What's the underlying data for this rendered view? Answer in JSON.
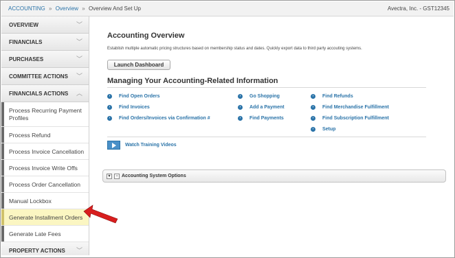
{
  "breadcrumb": {
    "items": [
      "ACCOUNTING",
      "Overview"
    ],
    "separator": "»",
    "current": "Overview And Set Up",
    "account": "Avectra, Inc. - GST12345"
  },
  "sidebar": {
    "sections": [
      {
        "label": "OVERVIEW",
        "chevron": "﹀"
      },
      {
        "label": "FINANCIALS",
        "chevron": "﹀"
      },
      {
        "label": "PURCHASES",
        "chevron": "﹀"
      },
      {
        "label": "COMMITTEE ACTIONS",
        "chevron": "﹀"
      },
      {
        "label": "FINANCIALS ACTIONS",
        "chevron": "︿"
      }
    ],
    "items": [
      "Process Recurring Payment Profiles",
      "Process Refund",
      "Process Invoice Cancellation",
      "Process Invoice Write Offs",
      "Process Order Cancellation",
      "Manual Lockbox",
      "Generate Installment Orders",
      "Generate Late Fees"
    ],
    "bottom_section": {
      "label": "PROPERTY ACTIONS",
      "chevron": "﹀"
    }
  },
  "main": {
    "title": "Accounting Overview",
    "description": "Establish multiple automatic pricing structures based on membership status and dates. Quickly export data to third party accouting systems.",
    "launch_button": "Launch Dashboard",
    "section_title": "Managing Your Accounting-Related Information",
    "links_col1": [
      "Find Open Orders",
      "Find Invoices",
      "Find Orders/Invoices via Confirmation #"
    ],
    "links_col2": [
      "Go Shopping",
      "Add a Payment",
      "Find Payments"
    ],
    "links_col3": [
      "Find Refunds",
      "Find Merchandise Fulfillment",
      "Find Subscription Fulfillment",
      "Setup"
    ],
    "video_link": "Watch Training Videos",
    "options_panel": "Accounting System Options"
  },
  "icons": {
    "link_bullet": "circle-arrow-icon",
    "video": "video-icon"
  },
  "colors": {
    "link": "#2a73a8",
    "highlight": "#fbf6c2",
    "annotation_arrow": "#d81e1e"
  }
}
